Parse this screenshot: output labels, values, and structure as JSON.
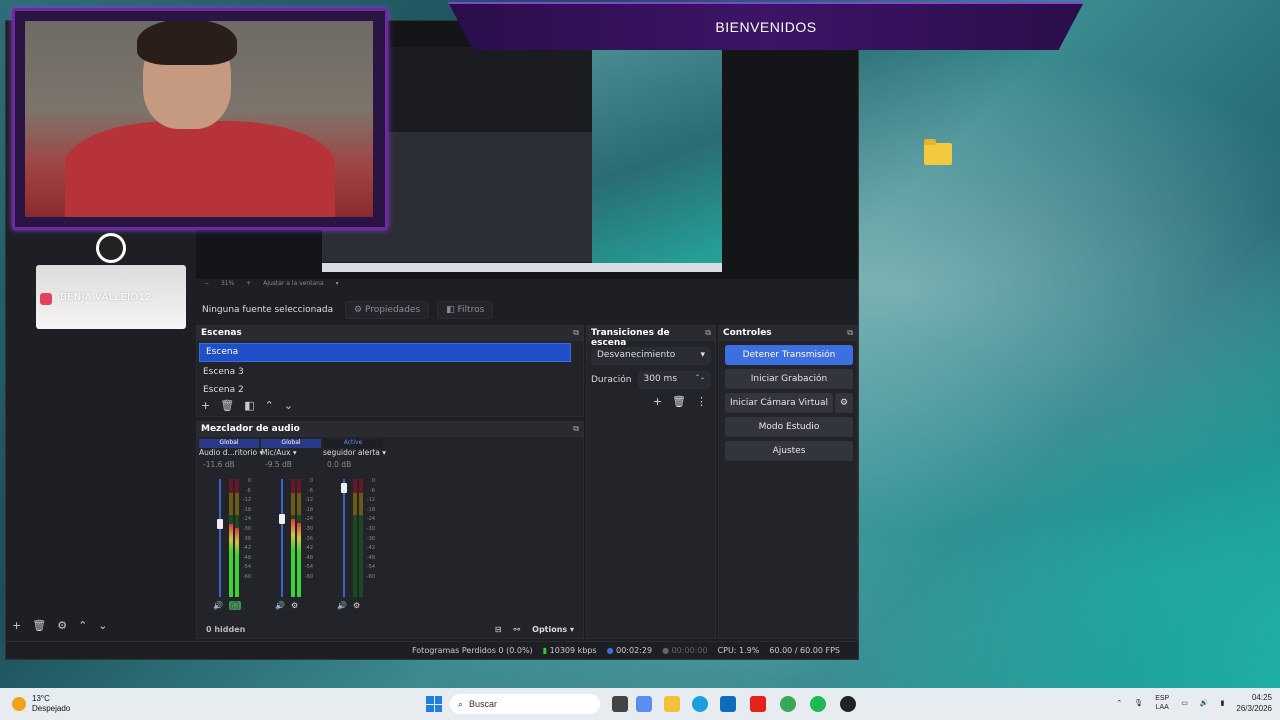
{
  "banner": {
    "title": "BIENVENIDOS"
  },
  "social": {
    "handle": "BENJA.VALLEJO12"
  },
  "preview": {
    "zoom": "31%",
    "fit_label": "Ajustar a la ventana"
  },
  "source_bar": {
    "no_source": "Ninguna fuente seleccionada",
    "properties": "Propiedades",
    "filters": "Filtros"
  },
  "scenes": {
    "title": "Escenas",
    "items": [
      "Escena",
      "Escena 3",
      "Escena 2"
    ]
  },
  "transitions": {
    "title": "Transiciones de escena",
    "selected": "Desvanecimiento",
    "duration_label": "Duración",
    "duration_value": "300 ms"
  },
  "controls": {
    "title": "Controles",
    "stop_stream": "Detener Transmisión",
    "start_recording": "Iniciar Grabación",
    "start_virtual_cam": "Iniciar Cámara Virtual",
    "studio_mode": "Modo Estudio",
    "settings": "Ajustes"
  },
  "mixer": {
    "title": "Mezclador de audio",
    "channels": [
      {
        "tag": "Global",
        "name": "Audio d...ritorio",
        "db": "-11.6 dB",
        "level": 0.62,
        "fader": 0.62
      },
      {
        "tag": "Global",
        "name": "Mic/Aux",
        "db": "-9.5 dB",
        "level": 0.66,
        "fader": 0.66
      },
      {
        "tag": "Active",
        "name": "seguidor alerta",
        "db": "0.0 dB",
        "level": 0.0,
        "fader": 0.92
      }
    ],
    "scale": [
      "0",
      "-6",
      "-12",
      "-18",
      "-24",
      "-30",
      "-36",
      "-42",
      "-48",
      "-54",
      "-60"
    ],
    "hidden": "0 hidden",
    "options": "Options"
  },
  "status": {
    "dropped": "Fotogramas Perdidos 0 (0.0%)",
    "bitrate": "10309 kbps",
    "stream_time": "00:02:29",
    "rec_time": "00:00:00",
    "cpu": "CPU: 1.9%",
    "fps": "60.00 / 60.00 FPS"
  },
  "taskbar": {
    "temp": "13°C",
    "weather": "Despejado",
    "search": "Buscar",
    "lang1": "ESP",
    "lang2": "LAA",
    "time": "04:25",
    "date": "26/3/2026"
  },
  "colors": {
    "accent": "#3c6fe0",
    "overlay_purple": "#6b2c9e"
  }
}
